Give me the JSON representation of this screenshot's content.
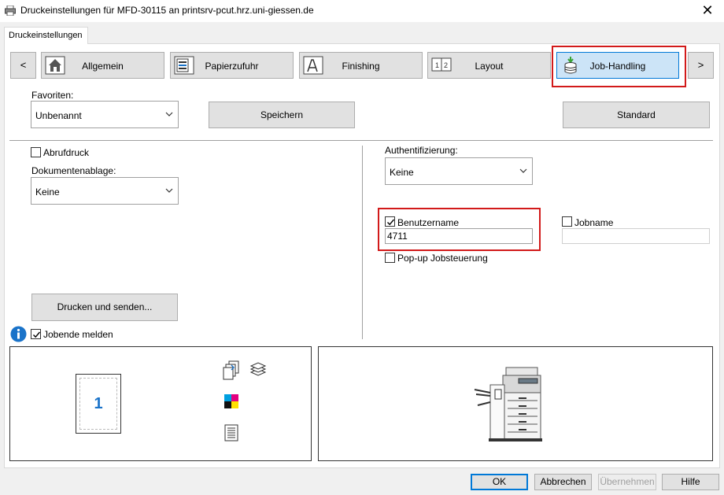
{
  "window": {
    "title": "Druckeinstellungen für MFD-30115 an printsrv-pcut.hrz.uni-giessen.de",
    "close_glyph": "✕"
  },
  "tab": {
    "label": "Druckeinstellungen"
  },
  "nav": {
    "prev": "<",
    "next": ">"
  },
  "categories": [
    {
      "label": "Allgemein",
      "icon": "home-icon"
    },
    {
      "label": "Papierzufuhr",
      "icon": "paper-tray-icon"
    },
    {
      "label": "Finishing",
      "icon": "finishing-icon"
    },
    {
      "label": "Layout",
      "icon": "layout-icon"
    },
    {
      "label": "Job-Handling",
      "icon": "job-handling-icon"
    }
  ],
  "favorites": {
    "label": "Favoriten:",
    "value": "Unbenannt",
    "save_label": "Speichern",
    "default_label": "Standard"
  },
  "left": {
    "abruf_label": "Abrufdruck",
    "abruf_checked": false,
    "ablage_label": "Dokumentenablage:",
    "ablage_value": "Keine",
    "print_send_label": "Drucken und senden...",
    "jobende_label": "Jobende melden",
    "jobende_checked": true
  },
  "right": {
    "auth_label": "Authentifizierung:",
    "auth_value": "Keine",
    "username_label": "Benutzername",
    "username_checked": true,
    "username_value": "4711",
    "jobname_label": "Jobname",
    "jobname_checked": false,
    "jobname_value": "",
    "popup_label": "Pop-up Jobsteuerung",
    "popup_checked": false
  },
  "preview": {
    "page_number": "1"
  },
  "footer": {
    "ok": "OK",
    "cancel": "Abbrechen",
    "apply": "Übernehmen",
    "help": "Hilfe"
  },
  "colors": {
    "highlight_red": "#d21a1a",
    "accent_blue": "#0078d7",
    "active_bg": "#cce4f7"
  }
}
